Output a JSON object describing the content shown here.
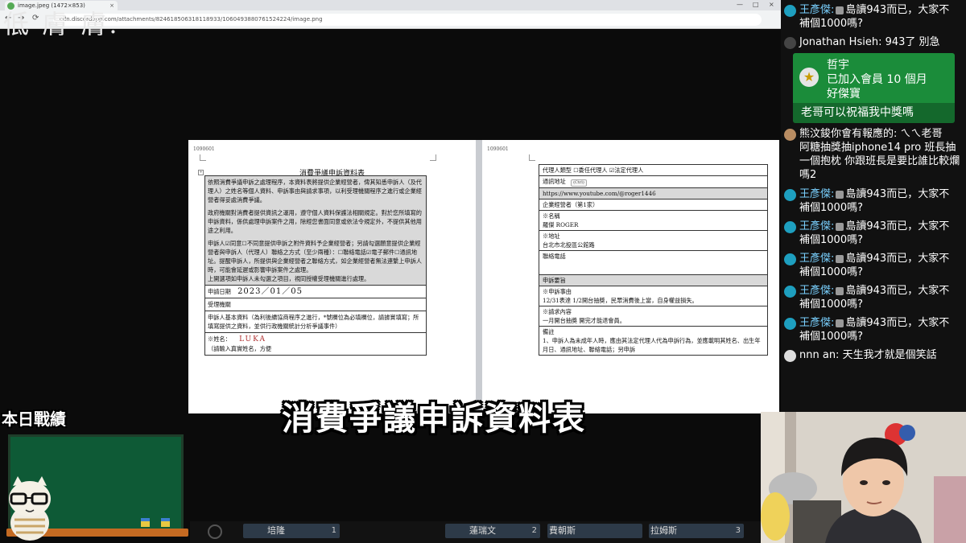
{
  "browser": {
    "tab_title": "image.jpeg (1472×853)",
    "url": "cdn.discordapp.com/attachments/824618506318118933/1060493880761524224/image.png",
    "back": "←",
    "forward": "→",
    "reload": "⟳",
    "close": "×",
    "min": "—",
    "max": "□"
  },
  "overlay_scratch": "低 膚 膚.",
  "document": {
    "left_page": {
      "page_number": "1090601",
      "title": "消費爭議申訴資料表",
      "para1": "依照消費爭議申訴之處理程序，本資料表將提供企業經營者，俾其知悉申訴人（及代理人）之姓名等個人資料、申訴事由與請求事項，以利受理機關程序之進行或企業經營者得妥處消費爭議。",
      "para2": "政府機關對消費者提供資訊之運用，遵守個人資料保護法相關規定。對於您所填寫的申訴資料，係供處理申訴案件之用，除經您書面同意或依法令規定外，不提供其他用途之利用。",
      "para3": "申訴人☑同意☐不同意提供申訴之附件資料予企業經營者；另請勾選願意提供企業經營者與申訴人（代理人）聯絡之方式（至少兩種）：☐聯絡電話☑電子郵件☐通訊地址。提醒申訴人，所提供與企業經營者之聯絡方式，如企業經營者無法連繫上申訴人時，可能會延遲或影響申訴案件之處理。",
      "para4": "上開選項如申訴人未勾選之項目，視同授權受理機關進行處理。",
      "date_label": "申請日期",
      "date_value": "2023／01／05",
      "agency_label": "受理機關",
      "basic_info": "申訴人基本資料（為利後續協商程序之進行，*號欄位為必填欄位，請據實填寫；所填寫提供之資料，並供行政機關統計分析爭議事件）",
      "name_label": "※姓名：",
      "name_value": "LUKA",
      "name_hint": "（請輸入真實姓名，方便"
    },
    "right_page": {
      "page_number": "1090601",
      "agent_type": "代理人類型 ☐委任代理人 ☑法定代理人",
      "address_label": "通訊地址",
      "ctrl_chip": "(Ctrl)",
      "url_value": "https://www.youtube.com/@roger1446",
      "company_label": "企業經營者（第1家）",
      "company_name_label": "※名稱",
      "company_name_value": "羅傑 ROGER",
      "company_address_label": "※地址",
      "company_address_value": "台北市北投區公館路",
      "phone_label": "聯絡電話",
      "complaint_section": "申訴要旨",
      "reason_label": "※申訴事由",
      "reason_value": "12/31表達 1/2開台抽獎，民眾消費後上當，自身權益損失。",
      "request_label": "※請求內容",
      "request_value": "一月開台抽獎 開完才能退會員。",
      "remarks_label": "備註",
      "remarks_value": "1、申訴人為未成年人時，應由其法定代理人代為申訴行為，並應載明其姓名、出生年月日、通訊地址、聯絡電話；另申訴"
    }
  },
  "subtitle": "消費爭議申訴資料表",
  "stats_label": "本日戰績",
  "bottom_bar": [
    {
      "name": "培隆",
      "num": "1"
    },
    {
      "name": "蓮瑞文",
      "num": "2"
    },
    {
      "name": "費朝斯",
      "num": ""
    },
    {
      "name": "拉姆斯",
      "num": "3"
    }
  ],
  "chat": {
    "messages": [
      {
        "user": "王彥傑:",
        "text": "島讀943而已，大家不",
        "text2": "補個1000嗎?",
        "blue": true
      },
      {
        "user": "Jonathan Hsieh:",
        "text": "943了 別急",
        "text2": "",
        "blue": false
      },
      {
        "user": "熊汶鋑你會有報應的:",
        "text": "ㄟㄟ老哥",
        "text2": "阿糖抽獎抽iphone14 pro 班長抽一個抱枕 你跟班長是要比誰比較爛嗎2",
        "blue": false
      },
      {
        "user": "王彥傑:",
        "text": "島讀943而已，大家不",
        "text2": "補個1000嗎?",
        "blue": true
      },
      {
        "user": "王彥傑:",
        "text": "島讀943而已，大家不",
        "text2": "補個1000嗎?",
        "blue": true
      },
      {
        "user": "王彥傑:",
        "text": "島讀943而已，大家不",
        "text2": "補個1000嗎?",
        "blue": true
      },
      {
        "user": "王彥傑:",
        "text": "島讀943而已，大家不",
        "text2": "補個1000嗎?",
        "blue": true
      },
      {
        "user": "王彥傑:",
        "text": "島讀943而已，大家不",
        "text2": "補個1000嗎?",
        "blue": true
      },
      {
        "user": "nnn an:",
        "text": "天生我才就是個笑話",
        "text2": "",
        "blue": false
      }
    ],
    "member": {
      "name": "哲宇",
      "line1": "已加入會員 10 個月",
      "line2": "好傑寶",
      "message": "老哥可以祝福我中獎嗎"
    }
  },
  "colors": {
    "chat_username": "#7ad1ff",
    "member_green": "#1b8c3a",
    "member_dark": "#14682c",
    "board_green": "#0e5a36"
  }
}
